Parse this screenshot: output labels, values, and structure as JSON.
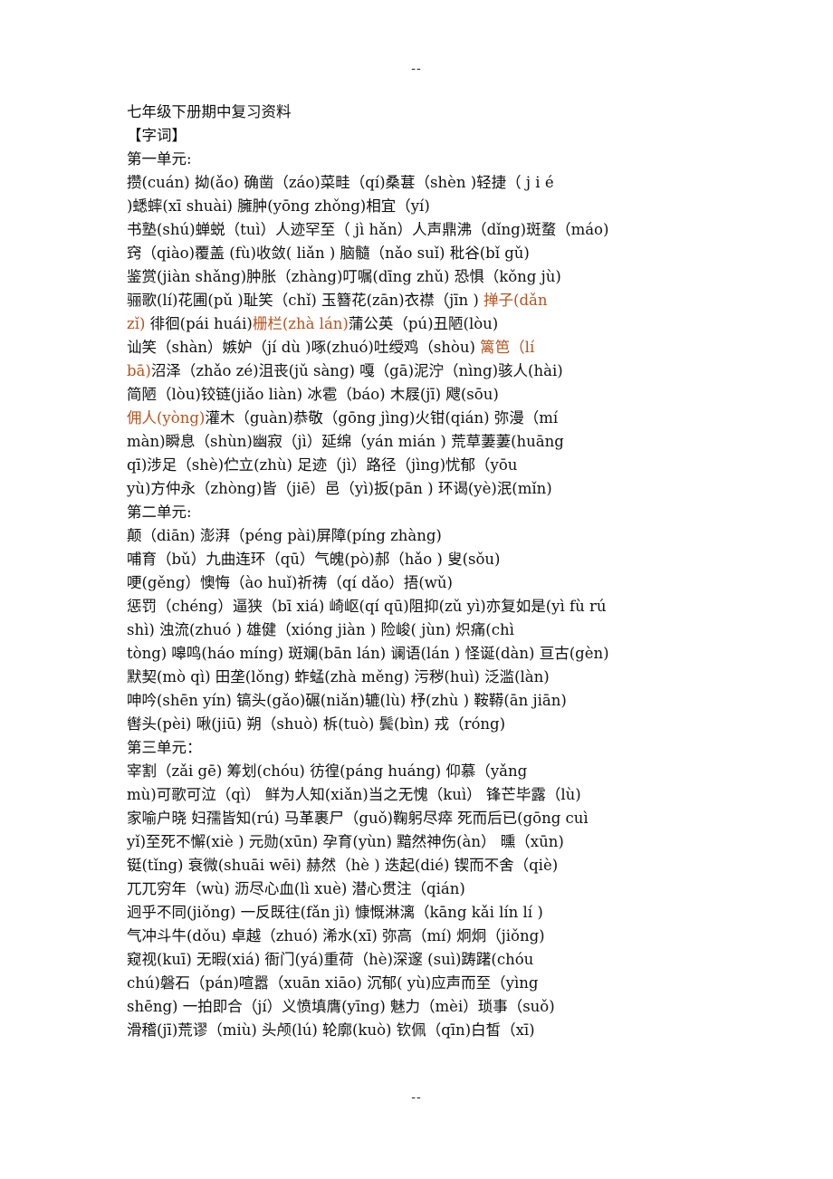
{
  "header_marker": "--",
  "footer_marker": "--",
  "highlight_color": "#B4541F",
  "document": {
    "title": "七年级下册期中复习资料",
    "section": "【字词】",
    "lines": [
      [
        {
          "t": "第一单元:"
        }
      ],
      [
        {
          "t": "攒(cuán) 拗(ǎo) 确凿（záo)菜畦（qí)桑葚（shèn )轻捷（ j i é"
        }
      ],
      [
        {
          "t": ")蟋蟀(xī  shuài) 臃肿(yōng zhǒng)相宜（yí)"
        }
      ],
      [
        {
          "t": "书塾(shú)蝉蜕（tuì）人迹罕至（ jì hǎn）人声鼎沸（dǐng)斑蝥（máo)"
        }
      ],
      [
        {
          "t": "窍（qiào)覆盖  (fù)收敛(  liǎn ) 脑髓（nǎo  suǐ) 秕谷(bǐ  gǔ)"
        }
      ],
      [
        {
          "t": "鉴赏(jiàn  shǎng)肿胀（zhàng)叮嘱(dīng zhǔ) 恐惧（kǒng jù)"
        }
      ],
      [
        {
          "t": "骊歌(lí)花圃(pǔ )耻笑（chǐ)  玉簪花(zān)衣襟（jīn )  "
        },
        {
          "t": "掸子(dǎn",
          "hl": true
        }
      ],
      [
        {
          "t": "zǐ)",
          "hl": true
        },
        {
          "t": " 徘徊(pái huái)"
        },
        {
          "t": "栅栏(zhà lán)",
          "hl": true
        },
        {
          "t": "蒲公英（pú)丑陋(lòu)"
        }
      ],
      [
        {
          "t": "讪笑（shàn）嫉妒（jí dù )啄(zhuó)吐绶鸡（shòu)  "
        },
        {
          "t": "篱笆（lí",
          "hl": true
        }
      ],
      [
        {
          "t": "bā)",
          "hl": true
        },
        {
          "t": "沼泽（zhǎo zé)沮丧(jǔ sàng) 嘎（gā)泥泞（nìng)骇人(hài)"
        }
      ],
      [
        {
          "t": "简陋（lòu)铰链(jiǎo  liàn)  冰雹（báo) 木屐(jī) 飕(sōu)"
        }
      ],
      [
        {
          "t": "佣人(yòng)",
          "hl": true
        },
        {
          "t": "灌木（guàn)恭敬（gōng jìng)火钳(qián) 弥漫（mí"
        }
      ],
      [
        {
          "t": "màn)瞬息（shùn)幽寂（jì）延绵（yán mián  ) 荒草萋萋(huāng"
        }
      ],
      [
        {
          "t": "qī)涉足（shè)伫立(zhù)  足迹（jì）路径（jìng)忧郁（yōu"
        }
      ],
      [
        {
          "t": "yù)方仲永（zhòng)皆（jiē）邑（yì)扳(pān  )  环谒(yè)泯(mǐn)"
        }
      ],
      [
        {
          "t": "第二单元:"
        }
      ],
      [
        {
          "t": "颠（diān) 澎湃（péng pài)屏障(píng zhàng)"
        }
      ],
      [
        {
          "t": "哺育（bǔ）九曲连环（qū）气魄(pò)郝（hǎo )  叟(sǒu)"
        }
      ],
      [
        {
          "t": "哽(gěng）懊悔（ào huǐ)祈祷（qí dǎo）捂(wǔ)"
        }
      ],
      [
        {
          "t": "惩罚（chéng）逼狭（bī xiá) 崎岖(qí qū)阻抑(zǔ yì)亦复如是(yì fù rú"
        }
      ],
      [
        {
          "t": "shì) 浊流(zhuó )  雄健（xióng jiàn  ) 险峻( jùn) 炽痛(chì"
        }
      ],
      [
        {
          "t": "tòng) 嗥鸣(háo míng) 斑斓(bān lán) 谰语(lán ) 怪诞(dàn) 亘古(gèn)"
        }
      ],
      [
        {
          "t": "默契(mò  qì) 田垄(lǒng) 蚱蜢(zhà měng)  污秽(huì) 泛滥(làn)"
        }
      ],
      [
        {
          "t": "呻吟(shēn  yín) 镐头(gǎo)碾(niǎn)辘(lù)  杼(zhù  ) 鞍鞯(ān jiān)"
        }
      ],
      [
        {
          "t": "辔头(pèi) 啾(jiū) 朔（shuò)  柝(tuò) 鬓(bìn) 戎（róng)"
        }
      ],
      [
        {
          "t": "第三单元："
        }
      ],
      [
        {
          "t": "宰割（zǎi gē) 筹划(chóu) 彷徨(páng  huáng) 仰慕（yǎng"
        }
      ],
      [
        {
          "t": "mù)可歌可泣（qì） 鲜为人知(xiǎn)当之无愧（kuì） 锋芒毕露（lù)"
        }
      ],
      [
        {
          "t": "家喻户晓  妇孺皆知(rú)  马革裹尸（guǒ)鞠躬尽瘁 死而后已(gōng  cuì"
        }
      ],
      [
        {
          "t": "yǐ)至死不懈(xiè  ) 元勋(xūn) 孕育(yùn) 黯然神伤(àn） 曛（xūn)"
        }
      ],
      [
        {
          "t": "铤(tǐng) 衰微(shuāi  wēi) 赫然（hè )  迭起(dié) 锲而不舍（qiè)"
        }
      ],
      [
        {
          "t": "兀兀穷年（wù)  沥尽心血(lì  xuè)  潜心贯注（qián)"
        }
      ],
      [
        {
          "t": "迥乎不同(jiǒng)  一反既往(fǎn jì) 慷慨淋漓（kāng kǎi lín  lí  )"
        }
      ],
      [
        {
          "t": "气冲斗牛(dǒu) 卓越（zhuó) 浠水(xī)  弥高（mí)  炯炯（jiǒng)"
        }
      ],
      [
        {
          "t": "窥视(kuī) 无暇(xiá)  衙门(yá)重荷（hè)深邃 (suì)踌躇(chóu"
        }
      ],
      [
        {
          "t": "chú)磐石（pán)喧嚣（xuān  xiāo)  沉郁( yù)应声而至（yìng"
        }
      ],
      [
        {
          "t": "shēng)  一拍即合（jí）义愤填膺(yīng) 魅力（mèi）琐事（suǒ)"
        }
      ],
      [
        {
          "t": "滑稽(jī)荒谬（miù) 头颅(lú) 轮廓(kuò) 钦佩（qīn)白皙（xī)"
        }
      ]
    ]
  }
}
